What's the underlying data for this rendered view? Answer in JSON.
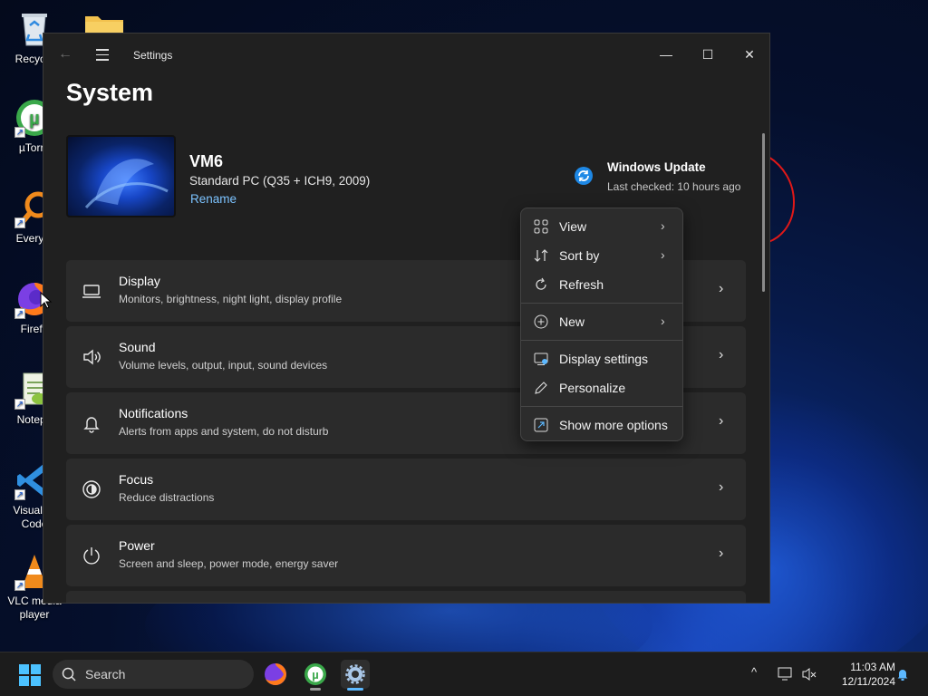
{
  "desktop": {
    "icons": [
      {
        "label": "Recycle"
      },
      {
        "label": "µTorre"
      },
      {
        "label": "Everyth"
      },
      {
        "label": "Firefo"
      },
      {
        "label": "Notepa"
      },
      {
        "label": "Visual St\nCode"
      },
      {
        "label": "VLC media\nplayer"
      }
    ]
  },
  "window": {
    "title": "Settings",
    "page_title": "System",
    "controls": {
      "minimize": "—",
      "maximize": "☐",
      "close": "✕"
    }
  },
  "device": {
    "name": "VM6",
    "model": "Standard PC (Q35 + ICH9, 2009)",
    "rename_label": "Rename"
  },
  "update": {
    "title": "Windows Update",
    "subtitle": "Last checked: 10 hours ago"
  },
  "cards": [
    {
      "title": "Display",
      "subtitle": "Monitors, brightness, night light, display profile",
      "icon": "monitor-icon"
    },
    {
      "title": "Sound",
      "subtitle": "Volume levels, output, input, sound devices",
      "icon": "speaker-icon"
    },
    {
      "title": "Notifications",
      "subtitle": "Alerts from apps and system, do not disturb",
      "icon": "bell-icon"
    },
    {
      "title": "Focus",
      "subtitle": "Reduce distractions",
      "icon": "focus-icon"
    },
    {
      "title": "Power",
      "subtitle": "Screen and sleep, power mode, energy saver",
      "icon": "power-icon"
    }
  ],
  "context_menu": {
    "items": [
      {
        "label": "View",
        "submenu": true,
        "icon": "grid-view-icon"
      },
      {
        "label": "Sort by",
        "submenu": true,
        "icon": "sort-icon"
      },
      {
        "label": "Refresh",
        "submenu": false,
        "icon": "refresh-icon"
      },
      {
        "label": "New",
        "submenu": true,
        "icon": "new-plus-icon"
      },
      {
        "label": "Display settings",
        "submenu": false,
        "icon": "display-settings-icon"
      },
      {
        "label": "Personalize",
        "submenu": false,
        "icon": "pen-icon"
      },
      {
        "label": "Show more options",
        "submenu": false,
        "icon": "more-options-icon"
      }
    ],
    "arrow": "›"
  },
  "taskbar": {
    "search_placeholder": "Search",
    "time": "11:03 AM",
    "date": "12/11/2024",
    "tray_chevron": "^"
  },
  "colors": {
    "accent": "#7cc3ff",
    "window_bg": "#202020",
    "card_bg": "#2b2b2b",
    "menu_bg": "#2c2c2c"
  }
}
